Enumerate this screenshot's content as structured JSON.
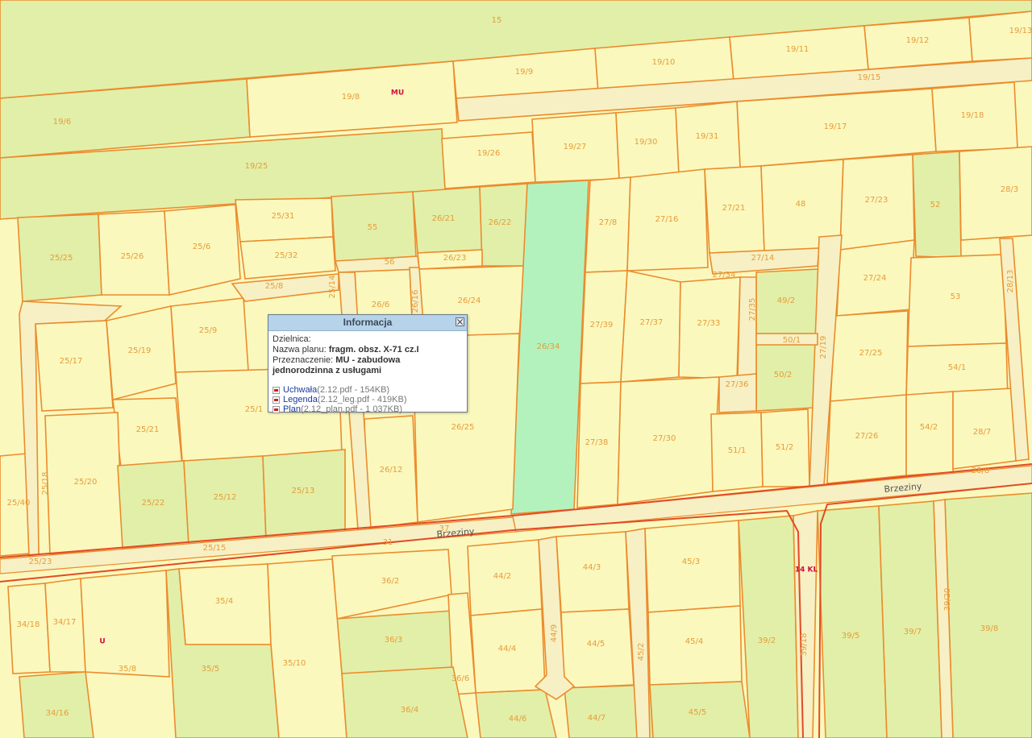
{
  "parcels": [
    {
      "id": "15",
      "label": "15"
    },
    {
      "id": "19/6",
      "label": "19/6"
    },
    {
      "id": "19/8",
      "label": "19/8"
    },
    {
      "id": "19/9",
      "label": "19/9"
    },
    {
      "id": "19/10",
      "label": "19/10"
    },
    {
      "id": "19/11",
      "label": "19/11"
    },
    {
      "id": "19/12",
      "label": "19/12"
    },
    {
      "id": "19/13",
      "label": "19/13"
    },
    {
      "id": "19/15",
      "label": "19/15"
    },
    {
      "id": "19/17",
      "label": "19/17"
    },
    {
      "id": "19/18",
      "label": "19/18"
    },
    {
      "id": "19/25",
      "label": "19/25"
    },
    {
      "id": "19/26",
      "label": "19/26"
    },
    {
      "id": "19/27",
      "label": "19/27"
    },
    {
      "id": "19/30",
      "label": "19/30"
    },
    {
      "id": "19/31",
      "label": "19/31"
    },
    {
      "id": "25/31",
      "label": "25/31"
    },
    {
      "id": "55",
      "label": "55"
    },
    {
      "id": "26/21",
      "label": "26/21"
    },
    {
      "id": "26/22",
      "label": "26/22"
    },
    {
      "id": "27/8",
      "label": "27/8"
    },
    {
      "id": "27/16",
      "label": "27/16"
    },
    {
      "id": "27/21",
      "label": "27/21"
    },
    {
      "id": "48",
      "label": "48"
    },
    {
      "id": "27/23",
      "label": "27/23"
    },
    {
      "id": "52",
      "label": "52"
    },
    {
      "id": "28/3",
      "label": "28/3"
    },
    {
      "id": "25/25",
      "label": "25/25"
    },
    {
      "id": "25/26",
      "label": "25/26"
    },
    {
      "id": "25/6",
      "label": "25/6"
    },
    {
      "id": "25/32",
      "label": "25/32"
    },
    {
      "id": "56",
      "label": "56"
    },
    {
      "id": "26/23",
      "label": "26/23"
    },
    {
      "id": "27/14",
      "label": "27/14"
    },
    {
      "id": "27/34",
      "label": "27/34"
    },
    {
      "id": "27/24",
      "label": "27/24"
    },
    {
      "id": "25/8",
      "label": "25/8"
    },
    {
      "id": "25/14",
      "label": "25/14"
    },
    {
      "id": "26/6",
      "label": "26/6"
    },
    {
      "id": "26/16",
      "label": "26/16"
    },
    {
      "id": "26/24",
      "label": "26/24"
    },
    {
      "id": "26/34",
      "label": "26/34"
    },
    {
      "id": "27/39",
      "label": "27/39"
    },
    {
      "id": "27/37",
      "label": "27/37"
    },
    {
      "id": "27/33",
      "label": "27/33"
    },
    {
      "id": "27/35",
      "label": "27/35"
    },
    {
      "id": "49/2",
      "label": "49/2"
    },
    {
      "id": "50/1",
      "label": "50/1"
    },
    {
      "id": "53",
      "label": "53"
    },
    {
      "id": "28/13",
      "label": "28/13"
    },
    {
      "id": "25/17",
      "label": "25/17"
    },
    {
      "id": "25/19",
      "label": "25/19"
    },
    {
      "id": "25/9",
      "label": "25/9"
    },
    {
      "id": "27/19",
      "label": "27/19"
    },
    {
      "id": "27/25",
      "label": "27/25"
    },
    {
      "id": "50/2",
      "label": "50/2"
    },
    {
      "id": "54/1",
      "label": "54/1"
    },
    {
      "id": "27/36",
      "label": "27/36"
    },
    {
      "id": "25/1",
      "label": "25/1"
    },
    {
      "id": "25/21",
      "label": "25/21"
    },
    {
      "id": "26/25",
      "label": "26/25"
    },
    {
      "id": "27/38",
      "label": "27/38"
    },
    {
      "id": "27/30",
      "label": "27/30"
    },
    {
      "id": "51/1",
      "label": "51/1"
    },
    {
      "id": "51/2",
      "label": "51/2"
    },
    {
      "id": "27/26",
      "label": "27/26"
    },
    {
      "id": "54/2",
      "label": "54/2"
    },
    {
      "id": "28/7",
      "label": "28/7"
    },
    {
      "id": "25/18",
      "label": "25/18"
    },
    {
      "id": "25/20",
      "label": "25/20"
    },
    {
      "id": "25/22",
      "label": "25/22"
    },
    {
      "id": "25/12",
      "label": "25/12"
    },
    {
      "id": "25/13",
      "label": "25/13"
    },
    {
      "id": "26/12",
      "label": "26/12"
    },
    {
      "id": "25/40",
      "label": "25/40"
    },
    {
      "id": "28/8",
      "label": "28/8"
    },
    {
      "id": "25/23",
      "label": "25/23"
    },
    {
      "id": "25/15",
      "label": "25/15"
    },
    {
      "id": "31",
      "label": "31"
    },
    {
      "id": "37",
      "label": "37"
    },
    {
      "id": "36/2",
      "label": "36/2"
    },
    {
      "id": "44/2",
      "label": "44/2"
    },
    {
      "id": "44/3",
      "label": "44/3"
    },
    {
      "id": "45/3",
      "label": "45/3"
    },
    {
      "id": "35/4",
      "label": "35/4"
    },
    {
      "id": "34/18",
      "label": "34/18"
    },
    {
      "id": "34/17",
      "label": "34/17"
    },
    {
      "id": "36/3",
      "label": "36/3"
    },
    {
      "id": "44/9",
      "label": "44/9"
    },
    {
      "id": "44/4",
      "label": "44/4"
    },
    {
      "id": "44/5",
      "label": "44/5"
    },
    {
      "id": "45/2",
      "label": "45/2"
    },
    {
      "id": "45/4",
      "label": "45/4"
    },
    {
      "id": "39/2",
      "label": "39/2"
    },
    {
      "id": "39/18",
      "label": "39/18"
    },
    {
      "id": "39/5",
      "label": "39/5"
    },
    {
      "id": "39/20",
      "label": "39/20"
    },
    {
      "id": "39/7",
      "label": "39/7"
    },
    {
      "id": "39/8",
      "label": "39/8"
    },
    {
      "id": "35/8",
      "label": "35/8"
    },
    {
      "id": "35/5",
      "label": "35/5"
    },
    {
      "id": "35/10",
      "label": "35/10"
    },
    {
      "id": "36/6",
      "label": "36/6"
    },
    {
      "id": "34/16",
      "label": "34/16"
    },
    {
      "id": "36/4",
      "label": "36/4"
    },
    {
      "id": "44/6",
      "label": "44/6"
    },
    {
      "id": "44/7",
      "label": "44/7"
    },
    {
      "id": "45/5",
      "label": "45/5"
    }
  ],
  "zones": [
    {
      "id": "mu",
      "label": "MU"
    },
    {
      "id": "kl",
      "label": "14 KL"
    },
    {
      "id": "u",
      "label": "U"
    }
  ],
  "roads": [
    {
      "id": "brzeziny-west",
      "label": "Brzeziny"
    },
    {
      "id": "brzeziny-east",
      "label": "Brzeziny"
    }
  ],
  "colors": {
    "parcel_fill": "#fbf8bd",
    "green_fill": "#e2efa8",
    "selected_fill": "#b4f2bd",
    "parcel_border": "#ea8c2e",
    "road_fill": "#f7f0c4",
    "boundary_line": "#e24a28"
  },
  "popup": {
    "title": "Informacja",
    "close_icon": "close-icon",
    "district_label": "Dzielnica:",
    "plan_label": "Nazwa planu:",
    "plan_value": "fragm. obsz. X-71 cz.I",
    "purpose_label": "Przeznaczenie:",
    "purpose_value": "MU - zabudowa jednorodzinna z usługami",
    "files": [
      {
        "name": "Uchwała",
        "meta": "(2.12.pdf - 154KB)",
        "icon": "pdf-icon"
      },
      {
        "name": "Legenda",
        "meta": "(2.12_leg.pdf - 419KB)",
        "icon": "pdf-icon"
      },
      {
        "name": "Plan",
        "meta": "(2.12_plan.pdf - 1 037KB)",
        "icon": "pdf-icon"
      }
    ]
  }
}
